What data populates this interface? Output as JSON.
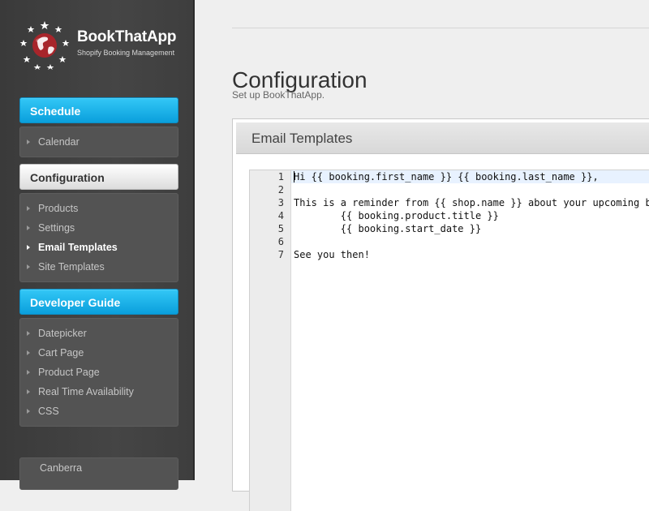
{
  "brand": {
    "name": "BookThatApp",
    "tagline": "Shopify Booking Management"
  },
  "sidebar": {
    "schedule": {
      "header": "Schedule",
      "items": [
        "Calendar"
      ]
    },
    "configuration": {
      "header": "Configuration",
      "items": [
        "Products",
        "Settings",
        "Email Templates",
        "Site Templates"
      ],
      "active": "Email Templates"
    },
    "developer_guide": {
      "header": "Developer Guide",
      "items": [
        "Datepicker",
        "Cart Page",
        "Product Page",
        "Real Time Availability",
        "CSS"
      ]
    },
    "footer_item": "Canberra"
  },
  "main": {
    "title": "Configuration",
    "subtitle": "Set up BookThatApp.",
    "card_title": "Email Templates",
    "editor": {
      "line_numbers": [
        "1",
        "2",
        "3",
        "4",
        "5",
        "6",
        "7"
      ],
      "lines": [
        "Hi {{ booking.first_name }} {{ booking.last_name }},",
        "",
        "This is a reminder from {{ shop.name }} about your upcoming booking:",
        "        {{ booking.product.title }}",
        "        {{ booking.start_date }}",
        "",
        "See you then!"
      ]
    }
  },
  "colors": {
    "accent_blue": "#0a9fdc",
    "sidebar_bg": "#424242",
    "page_bg": "#efefef"
  }
}
